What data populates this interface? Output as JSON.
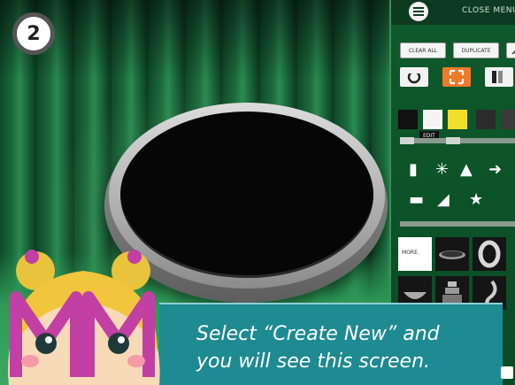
{
  "step": {
    "number": "2"
  },
  "panel": {
    "close_menu_label": "CLOSE MENU",
    "buttons": [
      {
        "label": "CLEAR ALL"
      },
      {
        "label": "DUPLICATE"
      }
    ],
    "edit_tooltip": "EDIT",
    "more_label": "MORE.",
    "colors": {
      "accent": "#f07a2a",
      "swatch_black": "#111111",
      "swatch_white": "#f4f4f4",
      "swatch_yellow": "#f2df2c",
      "swatch_dark1": "#2b2b2b",
      "swatch_dark2": "#3a3a3a"
    }
  },
  "caption": {
    "line1": "Select “Create New” and",
    "line2": "you will see this screen."
  }
}
